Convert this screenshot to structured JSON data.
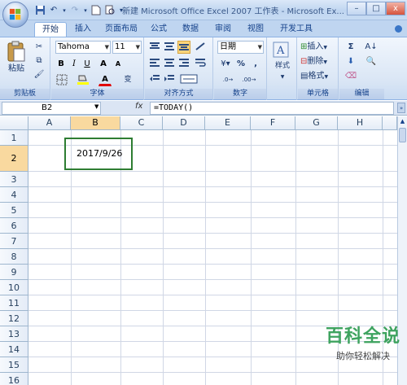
{
  "title_bar": {
    "title": "新建 Microsoft Office Excel 2007 工作表 - Microsoft Ex..."
  },
  "window_buttons": {
    "minimize": "–",
    "maximize": "□",
    "close": "x"
  },
  "tabs": [
    {
      "label": "开始",
      "active": true
    },
    {
      "label": "插入"
    },
    {
      "label": "页面布局"
    },
    {
      "label": "公式"
    },
    {
      "label": "数据"
    },
    {
      "label": "审阅"
    },
    {
      "label": "视图"
    },
    {
      "label": "开发工具"
    }
  ],
  "ribbon": {
    "clipboard": {
      "label": "剪贴板",
      "paste": "粘贴"
    },
    "font": {
      "label": "字体",
      "font_name": "Tahoma",
      "font_size": "11",
      "bold": "B",
      "italic": "I",
      "underline": "U",
      "grow": "A",
      "shrink": "A",
      "font_color": "A",
      "phonetic": "变"
    },
    "alignment": {
      "label": "对齐方式"
    },
    "number": {
      "label": "数字",
      "format": "日期",
      "percent": "%",
      "comma": ","
    },
    "styles": {
      "label": "样式"
    },
    "cells": {
      "label": "单元格",
      "insert": "插入",
      "delete": "删除",
      "format": "格式"
    },
    "editing": {
      "label": "编辑",
      "sum": "Σ"
    }
  },
  "formula_bar": {
    "name_box": "B2",
    "fx": "fx",
    "formula": "=TODAY()"
  },
  "columns": [
    "A",
    "B",
    "C",
    "D",
    "E",
    "F",
    "G",
    "H"
  ],
  "rows": [
    "1",
    "2",
    "3",
    "4",
    "5",
    "6",
    "7",
    "8",
    "9",
    "10",
    "11",
    "12",
    "13",
    "14",
    "15",
    "16"
  ],
  "cells": {
    "B2": "2017/9/26"
  },
  "selected_cell": "B2",
  "watermark": {
    "title": "百科全说",
    "subtitle": "助你轻松解决"
  },
  "colors": {
    "accent_green": "#2e7d32",
    "ribbon_blue": "#15428b",
    "selection_header": "#f9d99f"
  }
}
